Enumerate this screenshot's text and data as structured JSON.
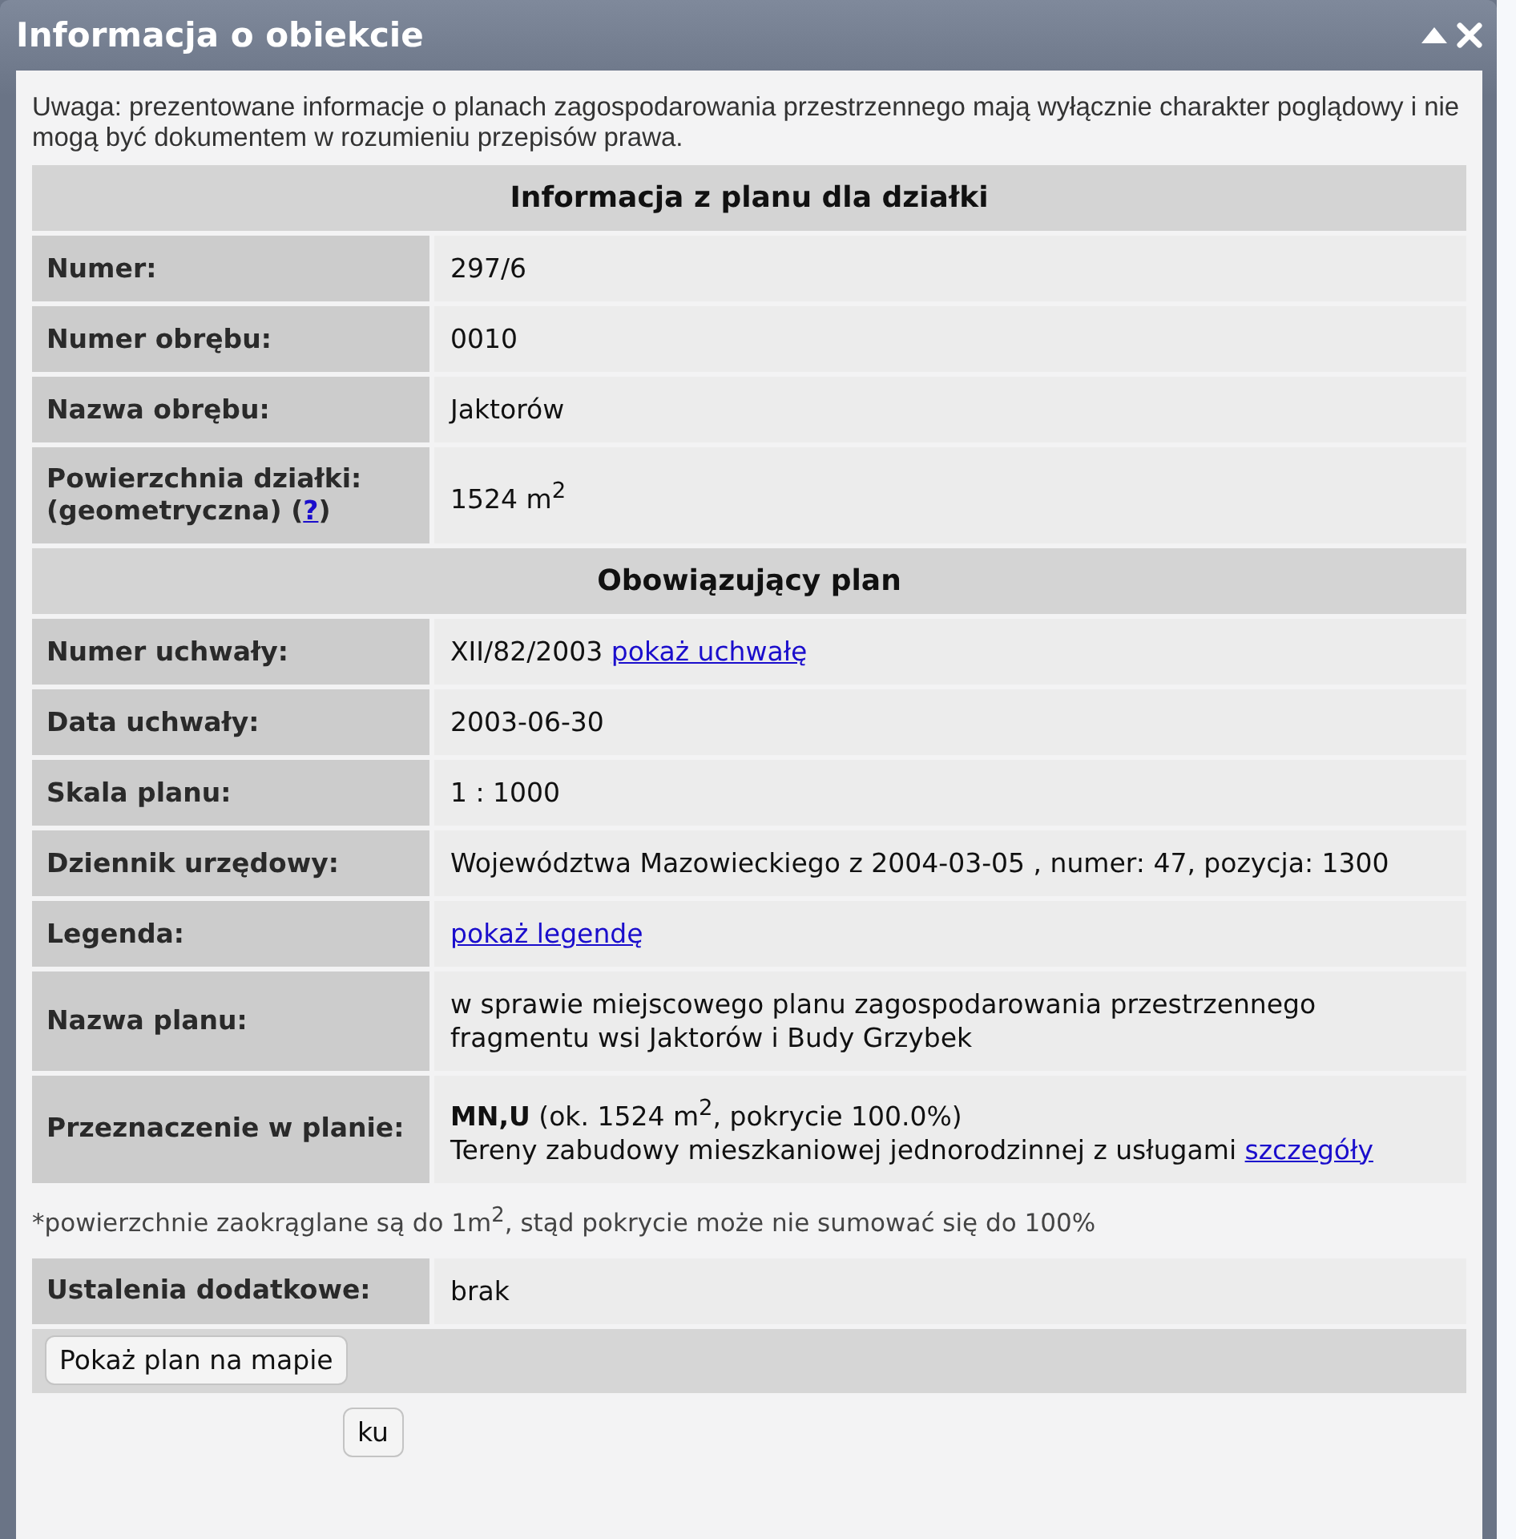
{
  "window": {
    "title": "Informacja o obiekcie"
  },
  "notice": "Uwaga: prezentowane informacje o planach zagospodarowania przestrzennego mają wyłącznie charakter poglądowy i nie mogą być dokumentem w rozumieniu przepisów prawa.",
  "sections": [
    {
      "title": "Informacja z planu dla działki",
      "rows": [
        {
          "label": "Numer:",
          "value_lines": [
            "297/6"
          ]
        },
        {
          "label": "Numer obrębu:",
          "value_lines": [
            "0010"
          ]
        },
        {
          "label": "Nazwa obrębu:",
          "value_lines": [
            "Jaktorów"
          ]
        },
        {
          "label": "Powierzchnia działki:",
          "label_line2": "(geometryczna) (",
          "label_link": "?",
          "label_after": ")",
          "value_lines": [
            "1524 m$^{2}$"
          ]
        }
      ]
    },
    {
      "title": "Obowiązujący plan",
      "rows": [
        {
          "label": "Numer uchwały:",
          "value_lines": [
            "XII/82/2003"
          ],
          "link": "pokaż uchwałę"
        },
        {
          "label": "Data uchwały:",
          "value_lines": [
            "2003-06-30"
          ]
        },
        {
          "label": "Skala planu:",
          "value_lines": [
            "1 : 1000"
          ]
        },
        {
          "label": "Dziennik urzędowy:",
          "value_lines": [
            "Województwa Mazowieckiego z 2004-03-05 , numer: 47, pozycja: 1300"
          ]
        },
        {
          "label": "Legenda:",
          "link": "pokaż legendę"
        },
        {
          "label": "Nazwa planu:",
          "value_lines": [
            "w sprawie miejscowego planu zagospodarowania przestrzennego fragmentu wsi Jaktorów i Budy Grzybek"
          ]
        },
        {
          "label": "Przeznaczenie w planie:",
          "value_lines": [
            "**MN,U** (ok. 1524 m$^{2}$, pokrycie 100.0%)",
            "Tereny zabudowy mieszkaniowej jednorodzinnej z usługami"
          ],
          "link": "szczegóły"
        }
      ]
    }
  ],
  "footnote": "*powierzchnie zaokrąglane są do 1m$^{2}$, stąd pokrycie może nie sumować się do 100%",
  "extra_rows": [
    {
      "label": "Ustalenia dodatkowe:",
      "value_lines": [
        "brak"
      ]
    }
  ],
  "buttons": [
    "Pokaż plan na mapie",
    "ku"
  ]
}
